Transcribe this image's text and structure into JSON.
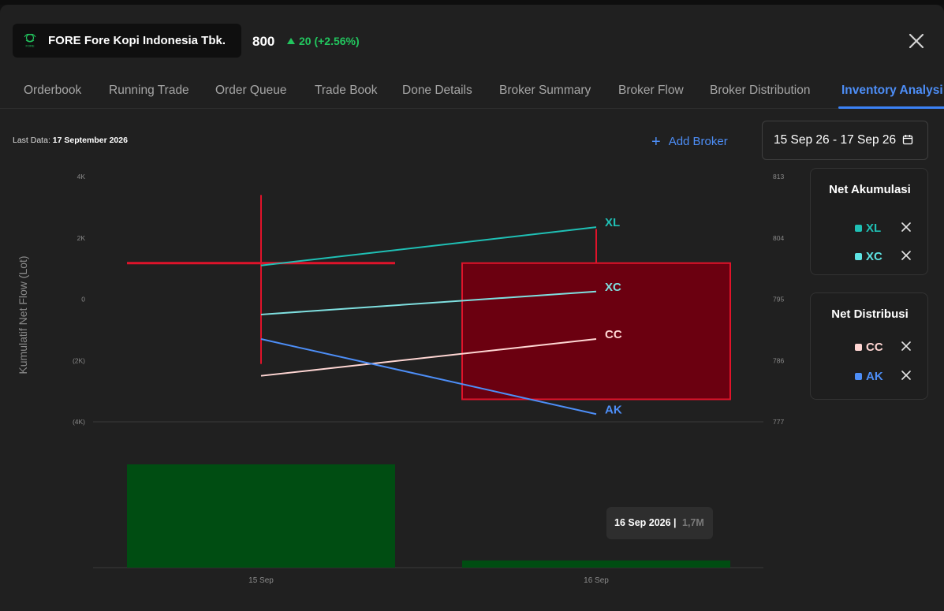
{
  "header": {
    "ticker_name": "FORE Fore Kopi Indonesia Tbk.",
    "logo_text": "FORE",
    "price": "800",
    "change": "20 (+2.56%)",
    "change_color": "#22c55e"
  },
  "tabs": [
    {
      "label": "Orderbook",
      "active": false
    },
    {
      "label": "Running Trade",
      "active": false
    },
    {
      "label": "Order Queue",
      "active": false
    },
    {
      "label": "Trade Book",
      "active": false
    },
    {
      "label": "Done Details",
      "active": false
    },
    {
      "label": "Broker Summary",
      "active": false
    },
    {
      "label": "Broker Flow",
      "active": false
    },
    {
      "label": "Broker Distribution",
      "active": false
    },
    {
      "label": "Inventory Analysi",
      "active": true
    }
  ],
  "toolbar": {
    "last_data_label": "Last Data:",
    "last_data_value": "17 September 2026",
    "add_broker": "Add Broker",
    "date_range": "15 Sep 26 - 17 Sep 26"
  },
  "legend": {
    "accumulation_title": "Net Akumulasi",
    "accumulation": [
      {
        "code": "XL",
        "color": "#1fc0b5"
      },
      {
        "code": "XC",
        "color": "#5ee3e3"
      }
    ],
    "distribution_title": "Net Distribusi",
    "distribution": [
      {
        "code": "CC",
        "color": "#ffd6d3"
      },
      {
        "code": "AK",
        "color": "#4d8ef7"
      }
    ]
  },
  "tooltip": {
    "date": "16 Sep 2026 |",
    "value": "1,7M"
  },
  "chart_data": {
    "type": "line",
    "ylabel": "Kumulatif Net Flow (Lot)",
    "x": [
      "15 Sep",
      "16 Sep"
    ],
    "left_axis": {
      "ticks": [
        "4K",
        "2K",
        "0",
        "(2K)",
        "(4K)"
      ],
      "values": [
        4000,
        2000,
        0,
        -2000,
        -4000
      ],
      "ylim": [
        -4000,
        4000
      ]
    },
    "right_axis": {
      "ticks": [
        "813",
        "804",
        "795",
        "786",
        "777"
      ],
      "values": [
        813,
        804,
        795,
        786,
        777
      ],
      "ylim": [
        777,
        813
      ]
    },
    "series": [
      {
        "name": "XL",
        "color": "#1fc0b5",
        "values": [
          1100,
          2350
        ]
      },
      {
        "name": "XC",
        "color": "#7fe0e0",
        "values": [
          -500,
          250
        ]
      },
      {
        "name": "CC",
        "color": "#ffd6d3",
        "values": [
          -2500,
          -1300
        ]
      },
      {
        "name": "AK",
        "color": "#4d8ef7",
        "values": [
          -1300,
          -3750
        ]
      }
    ],
    "price_candles": [
      {
        "x": "15 Sep",
        "open": 800.3,
        "close": 800.3,
        "high": 810.3,
        "low": 785.5,
        "color": "#e0132a"
      },
      {
        "x": "16 Sep",
        "open": 800.3,
        "close": 780.3,
        "high": 805.3,
        "low": 780.3,
        "color": "#e0132a",
        "fill": "#6b0010"
      }
    ],
    "volume": [
      {
        "x": "15 Sep",
        "value": 2.2,
        "color": "#004d12"
      },
      {
        "x": "16 Sep",
        "value": 1.7,
        "color": "#004d12"
      }
    ],
    "volume_unit": "M",
    "grid": false
  }
}
